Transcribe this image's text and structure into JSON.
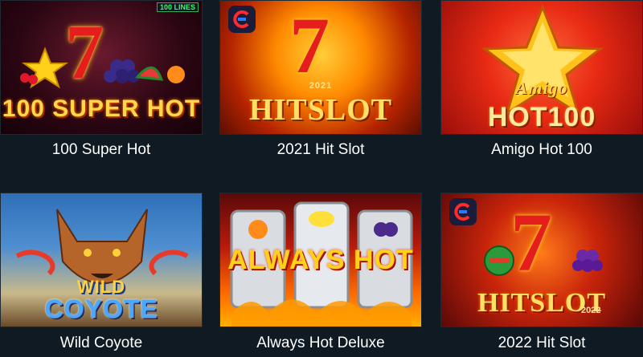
{
  "games": [
    {
      "title": "100 Super Hot",
      "logo": "100 SUPER HOT",
      "badge": "100 LINES"
    },
    {
      "title": "2021 Hit Slot",
      "logo": "HITSLOT",
      "year": "2021",
      "provider_icon": "egt-logo-icon"
    },
    {
      "title": "Amigo Hot 100",
      "logo_top": "Amigo",
      "logo": "HOT100"
    },
    {
      "title": "Wild Coyote",
      "logo_top": "WILD",
      "logo": "COYOTE"
    },
    {
      "title": "Always Hot Deluxe",
      "logo": "ALWAYS HOT"
    },
    {
      "title": "2022 Hit Slot",
      "logo": "HITSLOT",
      "year": "2022",
      "provider_icon": "egt-logo-icon"
    }
  ]
}
